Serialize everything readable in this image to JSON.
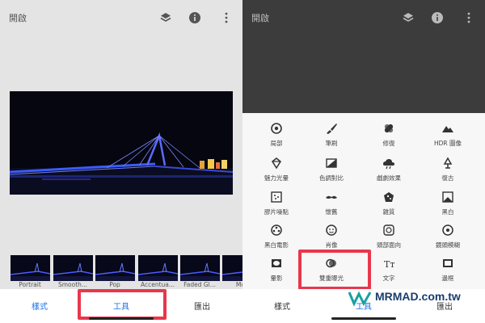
{
  "left": {
    "title": "開啟",
    "filters": [
      {
        "label": "Portrait"
      },
      {
        "label": "Smooth..."
      },
      {
        "label": "Pop"
      },
      {
        "label": "Accentua..."
      },
      {
        "label": "Faded Gl..."
      },
      {
        "label": "Mor"
      }
    ],
    "tabs": {
      "styles": "樣式",
      "tools": "工具",
      "export": "匯出"
    }
  },
  "right": {
    "title": "開啟",
    "tools": [
      {
        "label": "局部",
        "icon": "target-icon"
      },
      {
        "label": "筆刷",
        "icon": "brush-icon"
      },
      {
        "label": "修復",
        "icon": "bandage-icon"
      },
      {
        "label": "HDR 圖像",
        "icon": "mountain-icon"
      },
      {
        "label": "魅力光暈",
        "icon": "glamour-icon"
      },
      {
        "label": "色調對比",
        "icon": "tonal-contrast-icon"
      },
      {
        "label": "戲劇效果",
        "icon": "cloud-icon"
      },
      {
        "label": "復古",
        "icon": "lamp-icon"
      },
      {
        "label": "膠片噪點",
        "icon": "grain-icon"
      },
      {
        "label": "懷舊",
        "icon": "mustache-icon"
      },
      {
        "label": "雜質",
        "icon": "grunge-icon"
      },
      {
        "label": "黑白",
        "icon": "bw-icon"
      },
      {
        "label": "黑白電影",
        "icon": "film-reel-icon"
      },
      {
        "label": "肖像",
        "icon": "face-icon"
      },
      {
        "label": "頭部面向",
        "icon": "head-pose-icon"
      },
      {
        "label": "鏡頭模糊",
        "icon": "lens-blur-icon"
      },
      {
        "label": "暈影",
        "icon": "vignette-icon"
      },
      {
        "label": "雙重曝光",
        "icon": "double-exposure-icon"
      },
      {
        "label": "文字",
        "icon": "text-icon"
      },
      {
        "label": "邊框",
        "icon": "frame-icon"
      }
    ],
    "tabs": {
      "styles": "樣式",
      "tools": "工具",
      "export": "匯出"
    }
  },
  "watermark": {
    "text": "MRMAD.com.tw"
  },
  "colors": {
    "accent": "#1a73e8",
    "highlight": "#e8374c",
    "dark": "#3c3c3c"
  }
}
